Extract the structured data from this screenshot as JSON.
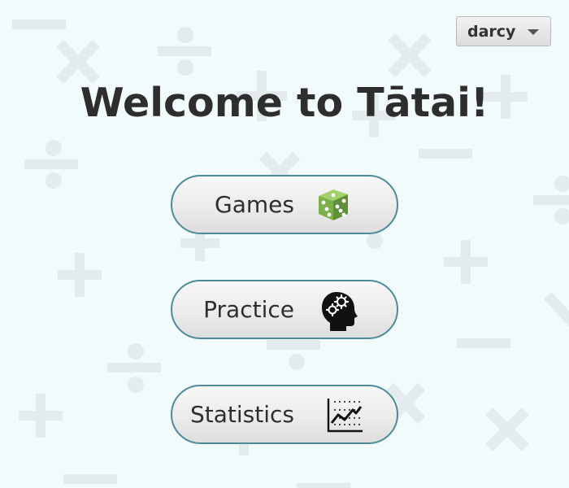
{
  "header": {
    "user_menu": {
      "username": "darcy",
      "icon": "chevron-down-icon"
    }
  },
  "main": {
    "title": "Welcome to Tātai!",
    "buttons": [
      {
        "label": "Games",
        "icon": "dice-icon",
        "icon_color": "#7bb04a"
      },
      {
        "label": "Practice",
        "icon": "head-gears-icon",
        "icon_color": "#111111"
      },
      {
        "label": "Statistics",
        "icon": "line-chart-icon",
        "icon_color": "#111111"
      }
    ]
  },
  "background": {
    "decoration": "faint math symbols (plus, minus, times, divide)",
    "color": "#f2fbfb",
    "symbol_color": "#e2eaec"
  },
  "theme": {
    "button_border": "#4d8a9a",
    "text": "#2e2e2e"
  }
}
